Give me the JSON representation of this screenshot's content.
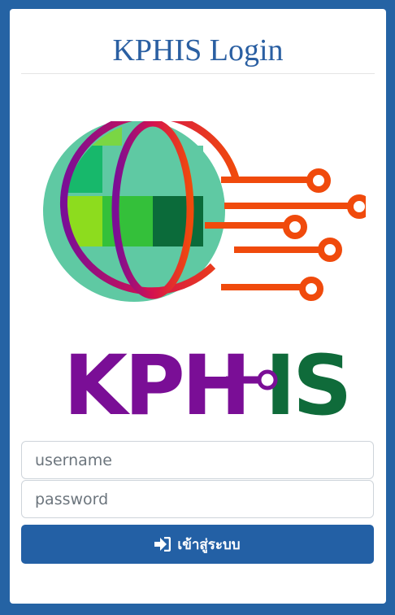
{
  "login": {
    "title": "KPHIS Login",
    "username_placeholder": "username",
    "password_placeholder": "password",
    "submit_label": "เข้าสู่ระบบ",
    "submit_icon": "sign-in-icon"
  },
  "logo": {
    "text_left": "KPH",
    "text_right": "IS",
    "colors": {
      "purple": "#7a0e96",
      "green": "#0f6b3a",
      "orange": "#f04a0c",
      "teal": "#5fc9a3"
    }
  },
  "colors": {
    "background": "#2563a4",
    "title": "#2a5fa2",
    "button": "#2360a5"
  }
}
